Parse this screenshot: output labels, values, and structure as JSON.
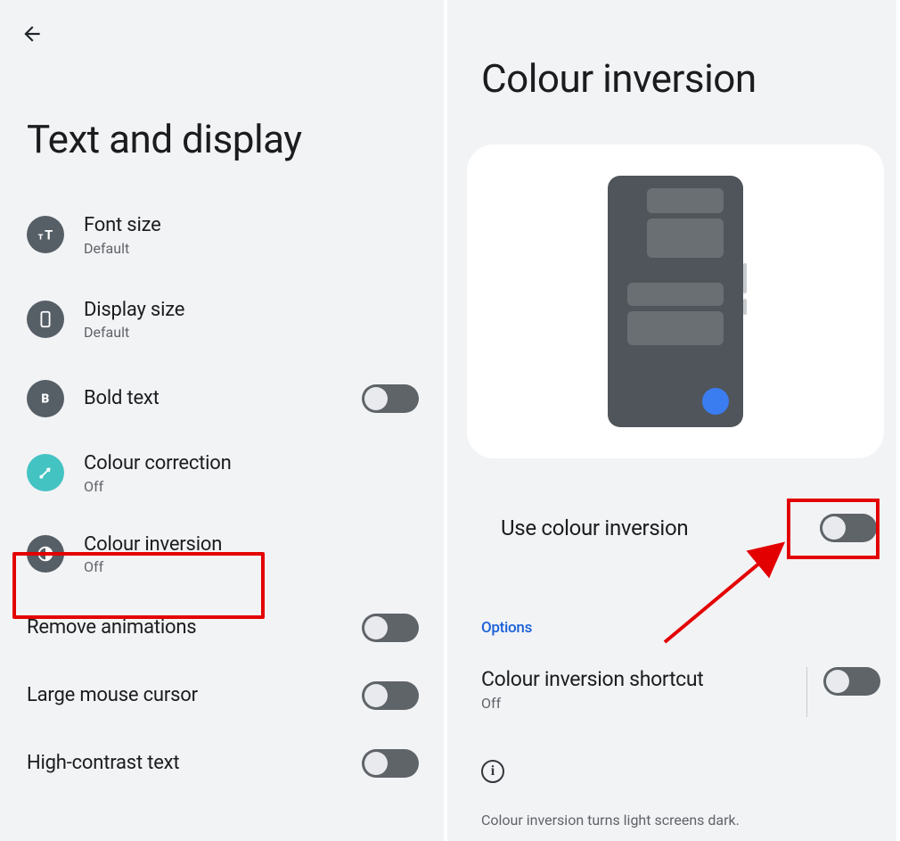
{
  "left": {
    "title": "Text and display",
    "items": {
      "font_size": {
        "title": "Font size",
        "sub": "Default"
      },
      "display_size": {
        "title": "Display size",
        "sub": "Default"
      },
      "bold_text": {
        "title": "Bold text"
      },
      "colour_correction": {
        "title": "Colour correction",
        "sub": "Off"
      },
      "colour_inversion": {
        "title": "Colour inversion",
        "sub": "Off"
      },
      "remove_anim": {
        "title": "Remove animations"
      },
      "large_cursor": {
        "title": "Large mouse cursor"
      },
      "high_contrast": {
        "title": "High-contrast text"
      }
    }
  },
  "right": {
    "title": "Colour inversion",
    "use_label": "Use colour inversion",
    "options_label": "Options",
    "shortcut_title": "Colour inversion shortcut",
    "shortcut_sub": "Off",
    "info_glyph": "i",
    "description": "Colour inversion turns light screens dark."
  }
}
